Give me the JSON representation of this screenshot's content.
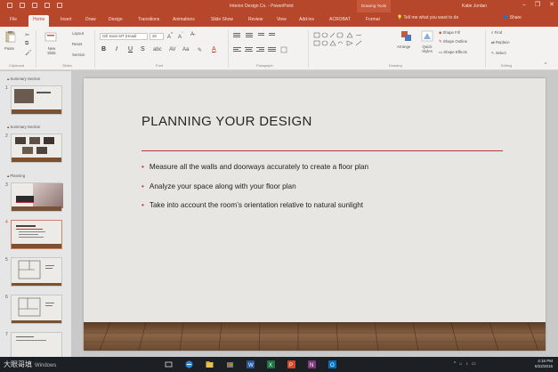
{
  "titlebar": {
    "document_title": "Interior Design Co. - PowerPoint",
    "context_tab": "Drawing Tools",
    "user": "Katie Jordan",
    "minimize": "–",
    "restore": "❐",
    "close": "✕"
  },
  "tabs": [
    {
      "label": "File"
    },
    {
      "label": "Home"
    },
    {
      "label": "Insert"
    },
    {
      "label": "Draw"
    },
    {
      "label": "Design"
    },
    {
      "label": "Transitions"
    },
    {
      "label": "Animations"
    },
    {
      "label": "Slide Show"
    },
    {
      "label": "Review"
    },
    {
      "label": "View"
    },
    {
      "label": "Add-ins"
    },
    {
      "label": "ACROBAT"
    },
    {
      "label": "Format"
    }
  ],
  "tell_me": "Tell me what you want to do",
  "share": "Share",
  "ribbon": {
    "paste": "Paste",
    "new_slide": "New Slide",
    "layout": "Layout",
    "reset": "Reset",
    "section": "Section",
    "font_name": "Gill Sans MT (Headi",
    "font_size": "28",
    "bold": "B",
    "italic": "I",
    "underline": "U",
    "strike": "S",
    "font_color": "A",
    "arrange": "Arrange",
    "quick_styles": "Quick Styles",
    "shape_fill": "Shape Fill",
    "shape_outline": "Shape Outline",
    "shape_effects": "Shape Effects",
    "find": "Find",
    "replace": "Replace",
    "select": "Select",
    "groups": {
      "clipboard": "Clipboard",
      "slides": "Slides",
      "font": "Font",
      "paragraph": "Paragraph",
      "drawing": "Drawing",
      "editing": "Editing"
    }
  },
  "thumbnails": {
    "sections": [
      "Summary Section",
      "Summary Section",
      "Planning"
    ],
    "numbers": [
      "1",
      "2",
      "3",
      "4",
      "5",
      "6",
      "7"
    ]
  },
  "slide": {
    "title": "PLANNING YOUR DESIGN",
    "bullets": [
      "Measure all the walls and doorways accurately to create a floor plan",
      "Analyze your space along with your floor plan",
      "Take into account the room’s orientation relative to natural sunlight"
    ]
  },
  "taskbar": {
    "watermark": "大眼哥填",
    "watermark_sub": "Windows",
    "time": "4:16 PM",
    "date": "6/22/2016"
  },
  "colors": {
    "accent": "#b7472a",
    "title_rule": "#b8333b"
  }
}
